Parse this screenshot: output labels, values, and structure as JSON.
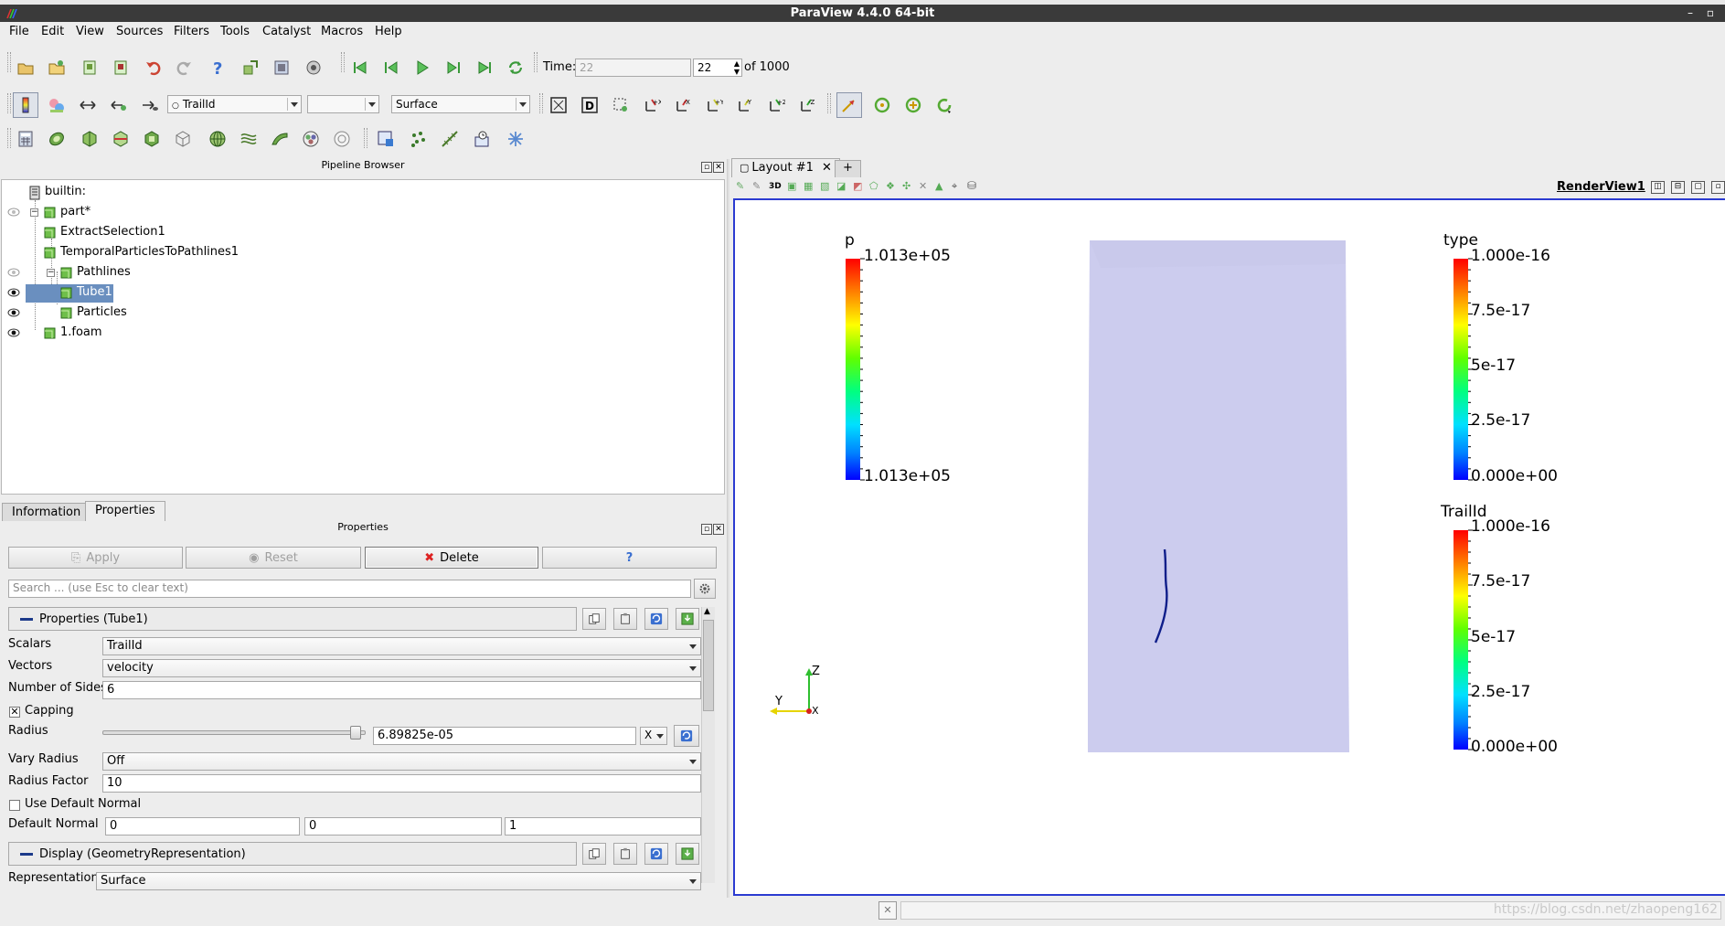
{
  "window": {
    "title": "ParaView 4.4.0 64-bit"
  },
  "menu": [
    "File",
    "Edit",
    "View",
    "Sources",
    "Filters",
    "Tools",
    "Catalyst",
    "Macros",
    "Help"
  ],
  "time": {
    "label": "Time:",
    "value": "22",
    "step": "22",
    "of": "of 1000"
  },
  "color_combo": {
    "value": "TrailId"
  },
  "component_combo": {
    "value": ""
  },
  "representation_combo": {
    "value": "Surface"
  },
  "pipeline": {
    "title": "Pipeline Browser",
    "items": [
      {
        "label": "builtin:"
      },
      {
        "label": "part*"
      },
      {
        "label": "ExtractSelection1"
      },
      {
        "label": "TemporalParticlesToPathlines1"
      },
      {
        "label": "Pathlines"
      },
      {
        "label": "Tube1"
      },
      {
        "label": "Particles"
      },
      {
        "label": "1.foam"
      }
    ]
  },
  "tabs": {
    "information": "Information",
    "properties": "Properties"
  },
  "properties": {
    "title": "Properties",
    "apply": "Apply",
    "reset": "Reset",
    "delete": "Delete",
    "help": "?",
    "search_placeholder": "Search ... (use Esc to clear text)",
    "section_props": "Properties (Tube1)",
    "section_display": "Display (GeometryRepresentation)",
    "scalars_label": "Scalars",
    "scalars_value": "TrailId",
    "vectors_label": "Vectors",
    "vectors_value": "velocity",
    "sides_label": "Number of Sides",
    "sides_value": "6",
    "capping_label": "Capping",
    "radius_label": "Radius",
    "radius_value": "6.89825e-05",
    "radius_slider": 0.96,
    "xbtn": "X",
    "vary_label": "Vary Radius",
    "vary_value": "Off",
    "factor_label": "Radius Factor",
    "factor_value": "10",
    "use_normal_label": "Use Default Normal",
    "normal_label": "Default Normal",
    "normal_values": [
      "0",
      "0",
      "1"
    ],
    "repr_label": "Representation",
    "repr_value": "Surface"
  },
  "layout": {
    "tab": "Layout #1",
    "add": "+",
    "view_name": "RenderView1",
    "btn_3d": "3D"
  },
  "render": {
    "bg_color": "#ffffff",
    "domain_color": "#ccccee",
    "bar_p": {
      "title": "p",
      "max": "1.013e+05",
      "min": "1.013e+05"
    },
    "bar_type": {
      "title": "type",
      "labels": [
        "1.000e-16",
        "7.5e-17",
        "5e-17",
        "2.5e-17",
        "0.000e+00"
      ]
    },
    "bar_trail": {
      "title": "TrailId",
      "labels": [
        "1.000e-16",
        "7.5e-17",
        "5e-17",
        "2.5e-17",
        "0.000e+00"
      ]
    },
    "axes": {
      "z": "Z",
      "y": "Y",
      "x": "X"
    }
  },
  "watermark": "https://blog.csdn.net/zhaopeng162"
}
